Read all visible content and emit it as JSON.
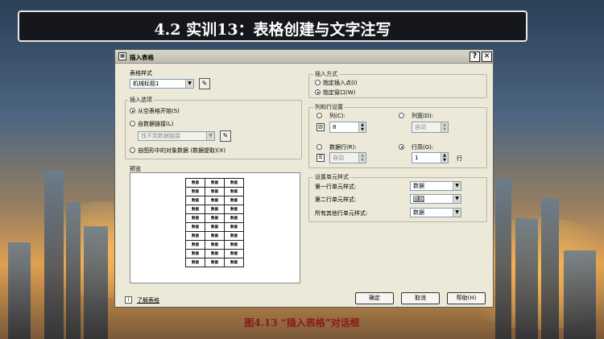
{
  "slide": {
    "title": "4.2 实训13：表格创建与文字注写",
    "caption": "图4.13 “插入表格”对话框"
  },
  "dialog": {
    "title": "插入表格",
    "help_btn": "?",
    "close_btn": "✕",
    "table_style": {
      "label": "表格样式",
      "value": "机械标题1"
    },
    "insert_options": {
      "label": "插入选项",
      "opt_empty": "从空表格开始(S)",
      "opt_link": "自数据链接(L)",
      "link_placeholder": "找不到数据链接",
      "opt_extract": "自图形中的对象数据 (数据提取)(X)"
    },
    "preview": {
      "label": "预览",
      "cell_text": "数据",
      "rows": 10,
      "cols": 3
    },
    "learn_link": "了解表格",
    "insert_method": {
      "label": "插入方式",
      "opt_point": "指定插入点(I)",
      "opt_window": "指定窗口(W)"
    },
    "rows_cols": {
      "label": "列和行设置",
      "cols_label": "列(C):",
      "cols_value": "8",
      "col_width_label": "列宽(D):",
      "col_width_value": "自动",
      "data_rows_label": "数据行(R):",
      "data_rows_value": "自动",
      "row_height_label": "行高(G):",
      "row_height_value": "1",
      "row_unit": "行"
    },
    "cell_styles": {
      "label": "设置单元样式",
      "first_row_label": "第一行单元样式:",
      "first_row_value": "数据",
      "second_row_label": "第二行单元样式:",
      "second_row_value": "数据",
      "other_rows_label": "所有其他行单元样式:",
      "other_rows_value": "数据"
    },
    "buttons": {
      "ok": "确定",
      "cancel": "取消",
      "help": "帮助(H)"
    }
  }
}
